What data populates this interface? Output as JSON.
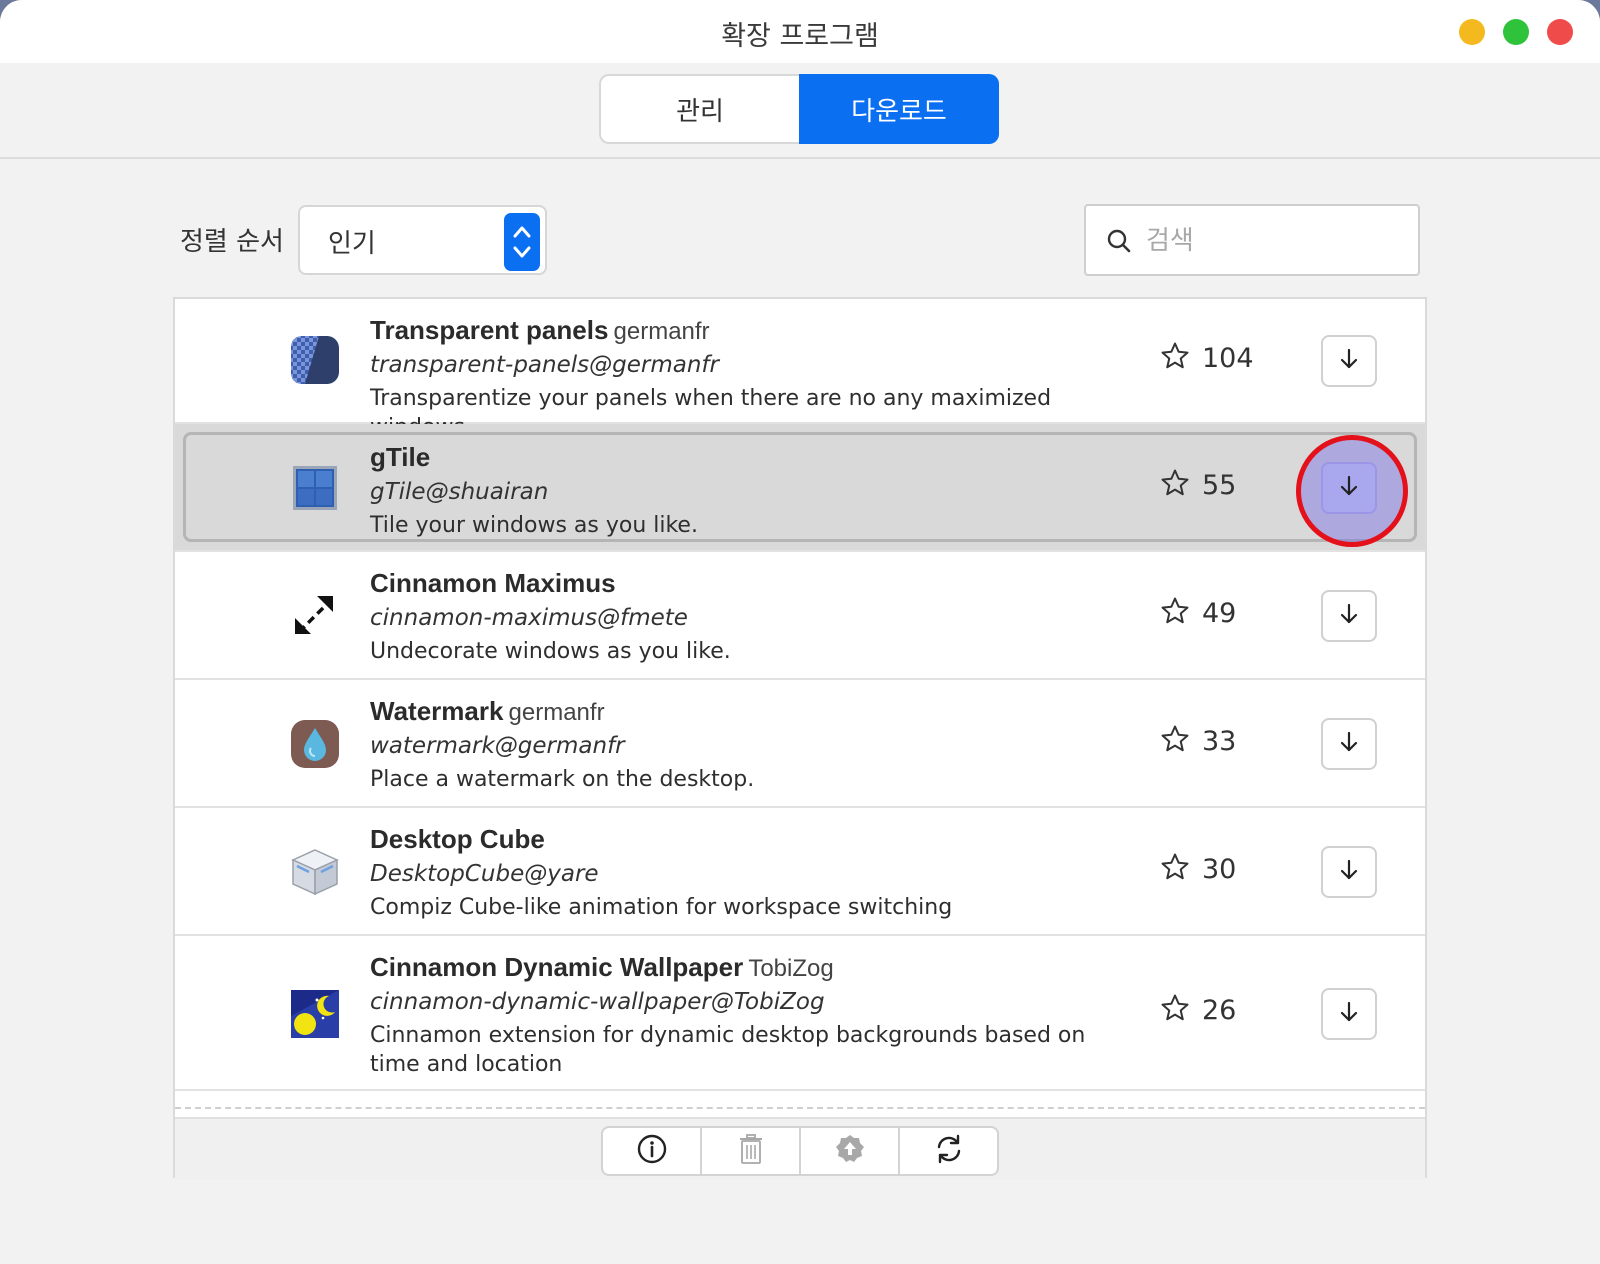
{
  "window": {
    "title": "확장 프로그램"
  },
  "tabs": [
    {
      "label": "관리",
      "active": false
    },
    {
      "label": "다운로드",
      "active": true
    }
  ],
  "sort": {
    "label": "정렬 순서",
    "value": "인기"
  },
  "search": {
    "placeholder": "검색",
    "value": ""
  },
  "colors": {
    "accent": "#0b6ff2",
    "highlight_circle": "#e4101a",
    "selected_row": "#d9d9d9"
  },
  "extensions": [
    {
      "name": "Transparent panels",
      "author": "germanfr",
      "uuid": "transparent-panels@germanfr",
      "description": "Transparentize your panels when there are no any maximized windows",
      "stars": "104",
      "icon": "checkerboard-panel-icon"
    },
    {
      "name": "gTile",
      "author": "",
      "uuid": "gTile@shuairan",
      "description": "Tile your windows as you like.",
      "stars": "55",
      "icon": "tile-grid-icon",
      "selected": true
    },
    {
      "name": "Cinnamon Maximus",
      "author": "",
      "uuid": "cinnamon-maximus@fmete",
      "description": "Undecorate windows as you like.",
      "stars": "49",
      "icon": "diagonal-arrows-icon"
    },
    {
      "name": "Watermark",
      "author": "germanfr",
      "uuid": "watermark@germanfr",
      "description": "Place a watermark on the desktop.",
      "stars": "33",
      "icon": "water-drop-icon"
    },
    {
      "name": "Desktop Cube",
      "author": "",
      "uuid": "DesktopCube@yare",
      "description": "Compiz Cube-like animation for workspace switching",
      "stars": "30",
      "icon": "cube-icon"
    },
    {
      "name": "Cinnamon Dynamic Wallpaper",
      "author": "TobiZog",
      "uuid": "cinnamon-dynamic-wallpaper@TobiZog",
      "description": "Cinnamon extension for dynamic desktop backgrounds based on time and location",
      "stars": "26",
      "icon": "moon-sun-icon"
    }
  ],
  "toolbar": {
    "buttons": [
      "info-icon",
      "trash-icon",
      "upgrade-icon",
      "refresh-icon"
    ]
  }
}
